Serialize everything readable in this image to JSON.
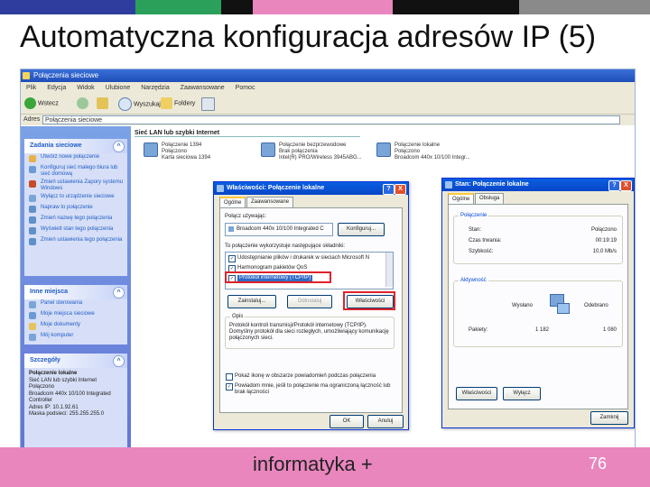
{
  "slide": {
    "title": "Automatyczna konfiguracja adresów IP (5)",
    "brand": "informatyka +",
    "page_number": "76",
    "colors": {
      "accent_pink": "#e986be",
      "bar_blue": "#2f3e9e",
      "bar_green": "#2aa05a",
      "bar_pink": "#e986be",
      "bar_gray": "#8a8a8a",
      "bar_black": "#111111"
    }
  },
  "explorer": {
    "title": "Połączenia sieciowe",
    "menu": [
      "Plik",
      "Edycja",
      "Widok",
      "Ulubione",
      "Narzędzia",
      "Zaawansowane",
      "Pomoc"
    ],
    "toolbar": {
      "back": "Wstecz",
      "search": "Wyszukaj",
      "folders": "Foldery"
    },
    "address_label": "Adres",
    "address_value": "Połączenia sieciowe",
    "section_header": "Sieć LAN lub szybki Internet",
    "connections": [
      {
        "line1": "Połączenie 1394",
        "line2": "Połączono",
        "line3": "Karta sieciowa 1394"
      },
      {
        "line1": "Połączenie bezprzewodowe",
        "line2": "Brak połączenia",
        "line3": "Intel(R) PRO/Wireless 3945ABG..."
      },
      {
        "line1": "Połączenie lokalne",
        "line2": "Połączono",
        "line3": "Broadcom 440x 10/100 Integr..."
      }
    ],
    "tasks_panel": {
      "title": "Zadania sieciowe",
      "items": [
        "Utwórz nowe połączenie",
        "Konfiguruj sieć małego biura lub sieć domową",
        "Zmień ustawienia Zapory systemu Windows",
        "Wyłącz to urządzenie sieciowe",
        "Napraw to połączenie",
        "Zmień nazwę tego połączenia",
        "Wyświetl stan tego połączenia",
        "Zmień ustawienia tego połączenia"
      ]
    },
    "places_panel": {
      "title": "Inne miejsca",
      "items": [
        "Panel sterowania",
        "Moje miejsca sieciowe",
        "Moje dokumenty",
        "Mój komputer"
      ]
    },
    "details_panel": {
      "title": "Szczegóły",
      "name": "Połączenie lokalne",
      "lines": [
        "Sieć LAN lub szybki Internet",
        "Połączono",
        "Broadcom 440x 10/100 Integrated Controller",
        "Adres IP: 10.1.92.61",
        "Maska podsieci: 255.255.255.0"
      ]
    }
  },
  "properties_dialog": {
    "title": "Właściwości: Połączenie lokalne",
    "help_btn": "?",
    "close_btn": "X",
    "tabs": [
      "Ogólne",
      "Zaawansowane"
    ],
    "connect_using_label": "Połącz używając:",
    "adapter": "Broadcom 440x 10/100 Integrated C",
    "configure_btn": "Konfiguruj...",
    "components_label": "To połączenie wykorzystuje następujące składniki:",
    "components": [
      {
        "label": "Udostępnianie plików i drukarek w sieciach Microsoft N",
        "checked": true
      },
      {
        "label": "Harmonogram pakietów QoS",
        "checked": true
      },
      {
        "label": "Protokół internetowy (TCP/IP)",
        "checked": true
      }
    ],
    "install_btn": "Zainstaluj...",
    "uninstall_btn": "Odinstaluj",
    "properties_btn": "Właściwości",
    "description_label": "Opis",
    "description_text": "Protokół kontroli transmisji/Protokół internetowy (TCP/IP). Domyślny protokół dla sieci rozległych, umożliwiający komunikację połączonych sieci.",
    "option1": "Pokaż ikonę w obszarze powiadomień podczas połączenia",
    "option2": "Powiadom mnie, jeśli to połączenie ma ograniczoną łączność lub brak łączności",
    "option1_checked": false,
    "option2_checked": true,
    "ok_btn": "OK",
    "cancel_btn": "Anuluj"
  },
  "status_dialog": {
    "title": "Stan: Połączenie lokalne",
    "help_btn": "?",
    "close_btn": "X",
    "tabs": [
      "Ogólne",
      "Obsługa"
    ],
    "connection_group": "Połączenie",
    "status_label": "Stan:",
    "status_value": "Połączono",
    "duration_label": "Czas trwania:",
    "duration_value": "00:19:19",
    "speed_label": "Szybkość:",
    "speed_value": "10,0 Mb/s",
    "activity_group": "Aktywność",
    "sent_label": "Wysłano",
    "received_label": "Odebrano",
    "packets_label": "Pakiety:",
    "packets_sent": "1 182",
    "packets_received": "1 080",
    "properties_btn": "Właściwości",
    "disable_btn": "Wyłącz",
    "close_button": "Zamknij"
  }
}
